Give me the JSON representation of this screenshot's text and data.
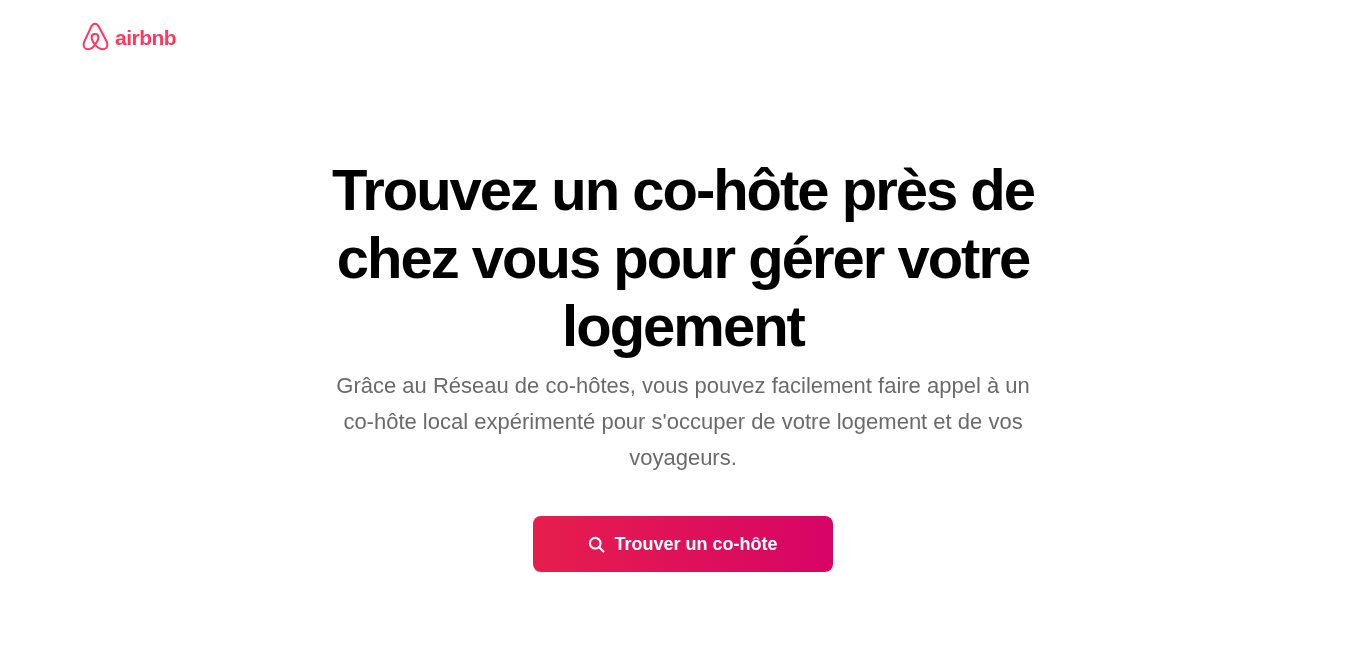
{
  "header": {
    "logo_text": "airbnb"
  },
  "hero": {
    "title": "Trouvez un co-hôte près de chez vous pour gérer votre logement",
    "subtitle": "Grâce au Réseau de co-hôtes, vous pouvez facilement faire appel à un co-hôte local expérimenté pour s'occuper de votre logement et de vos voyageurs.",
    "button": {
      "label": "Trouver un co-hôte"
    }
  }
}
